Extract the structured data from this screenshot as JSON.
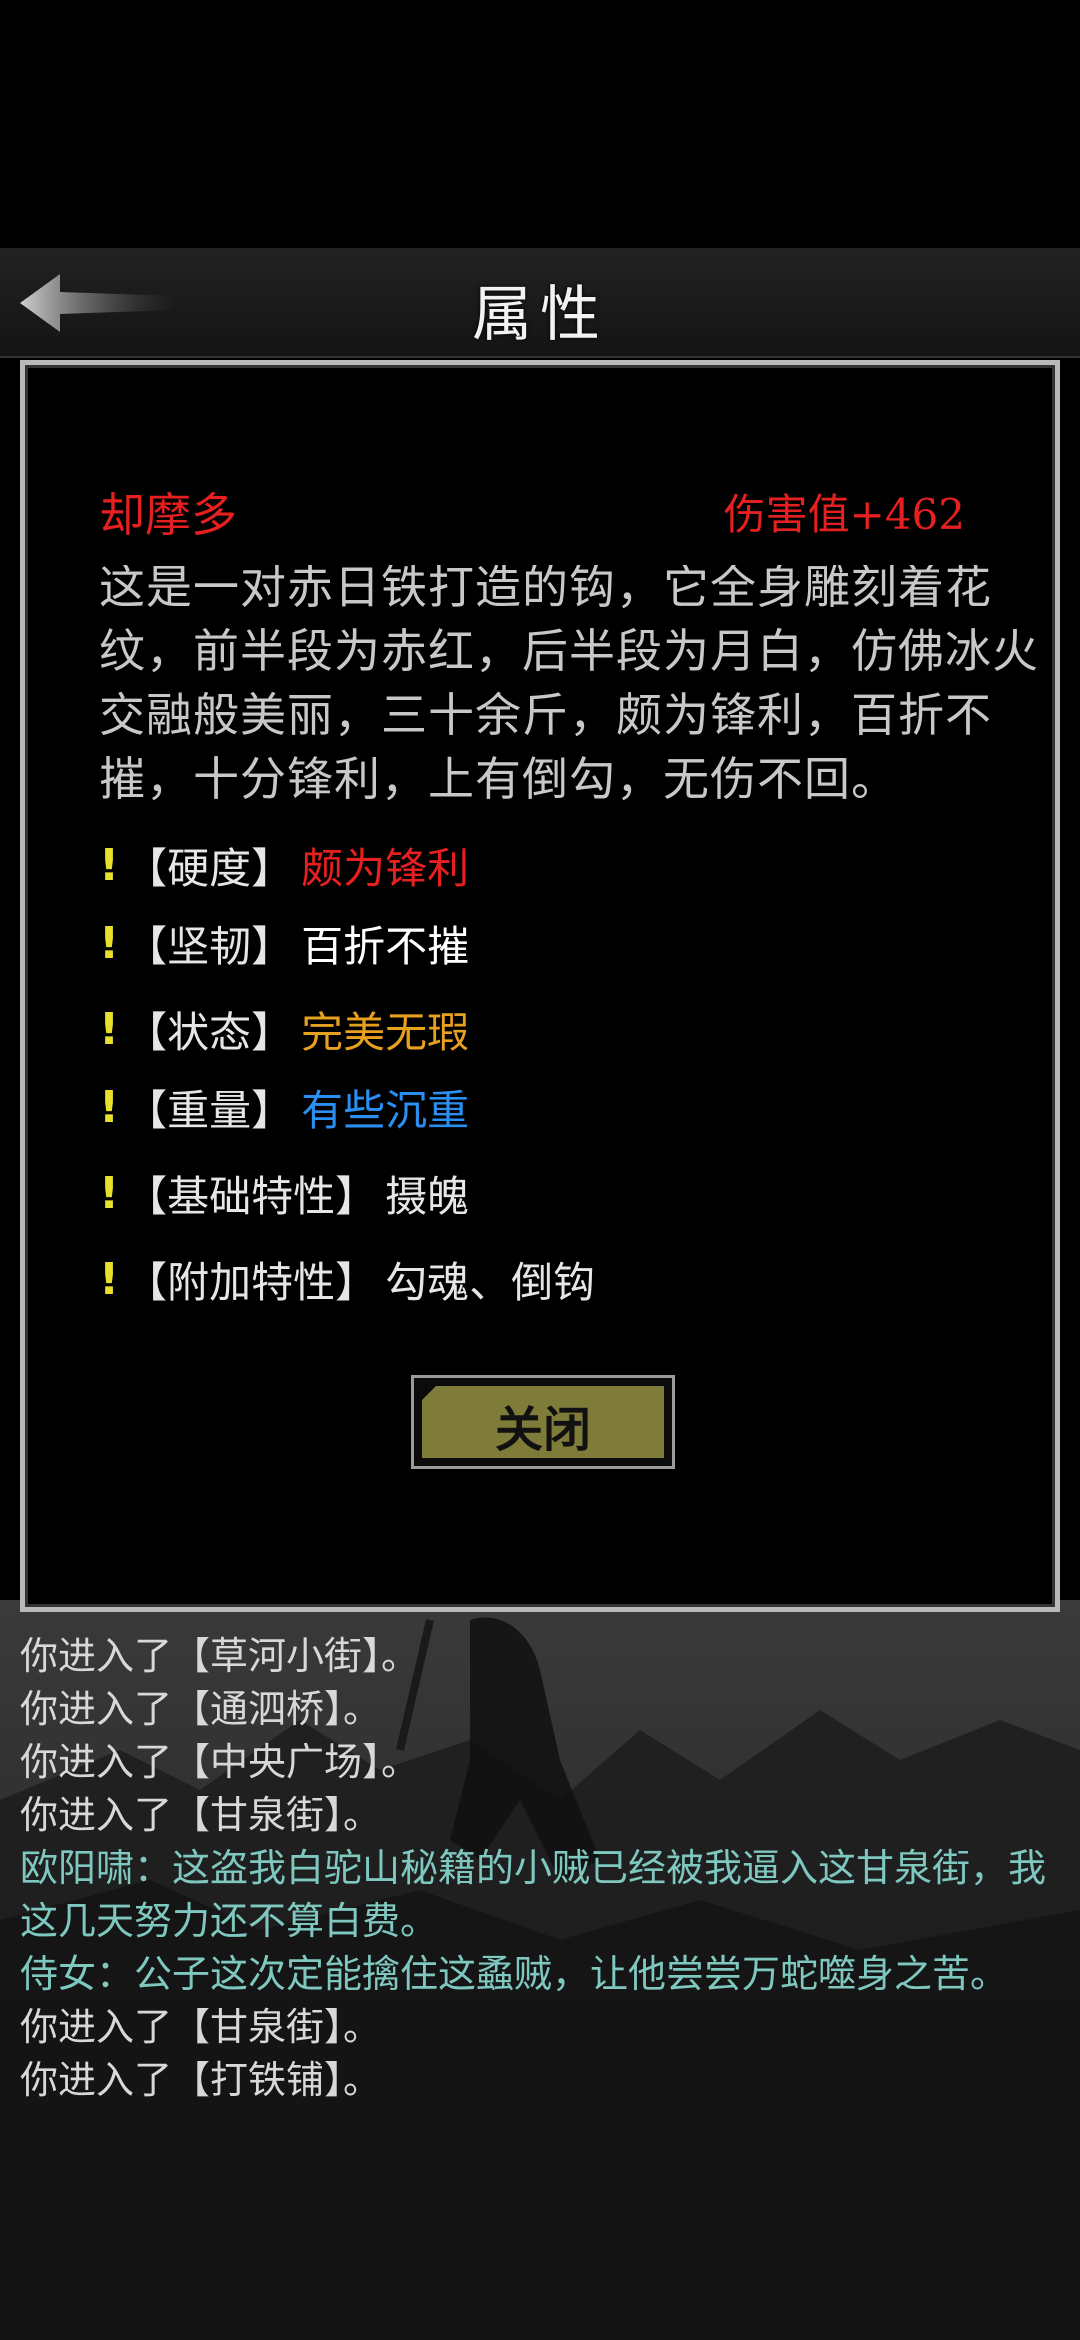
{
  "header": {
    "title": "属性",
    "back_icon": "arrow-left-icon"
  },
  "item": {
    "name": "却摩多",
    "damage": "伤害值+462",
    "description": "这是一对赤日铁打造的钩，它全身雕刻着花纹，前半段为赤红，后半段为月白，仿佛冰火交融般美丽，三十余斤，颇为锋利，百折不摧，十分锋利，上有倒勾，无伤不回。"
  },
  "attributes": [
    {
      "bang": "!",
      "key": "【硬度】",
      "value": "颇为锋利",
      "color": "#e62020"
    },
    {
      "bang": "!",
      "key": "【坚韧】",
      "value": "百折不摧",
      "color": "#ffffff"
    },
    {
      "bang": "!",
      "key": "【状态】",
      "value": "完美无瑕",
      "color": "#e8a020"
    },
    {
      "bang": "!",
      "key": "【重量】",
      "value": "有些沉重",
      "color": "#2a8ff0"
    },
    {
      "bang": "!",
      "key": "【基础特性】",
      "value": "摄魄",
      "color": "#e6e6e6"
    },
    {
      "bang": "!",
      "key": "【附加特性】",
      "value": "勾魂、倒钩",
      "color": "#e6e6e6"
    }
  ],
  "close_button": {
    "label": "关闭"
  },
  "log": [
    {
      "text": "你进入了【草河小街】。",
      "color": "#d8d8d8"
    },
    {
      "text": "你进入了【通泗桥】。",
      "color": "#d8d8d8"
    },
    {
      "text": "你进入了【中央广场】。",
      "color": "#d8d8d8"
    },
    {
      "text": "你进入了【甘泉街】。",
      "color": "#d8d8d8"
    },
    {
      "text": "欧阳啸：这盗我白驼山秘籍的小贼已经被我逼入这甘泉街，我这几天努力还不算白费。",
      "color": "#7ec8c0"
    },
    {
      "text": "侍女：公子这次定能擒住这蟊贼，让他尝尝万蛇噬身之苦。",
      "color": "#7ec8c0"
    },
    {
      "text": "你进入了【甘泉街】。",
      "color": "#d8d8d8"
    },
    {
      "text": "你进入了【打铁铺】。",
      "color": "#d8d8d8"
    }
  ]
}
